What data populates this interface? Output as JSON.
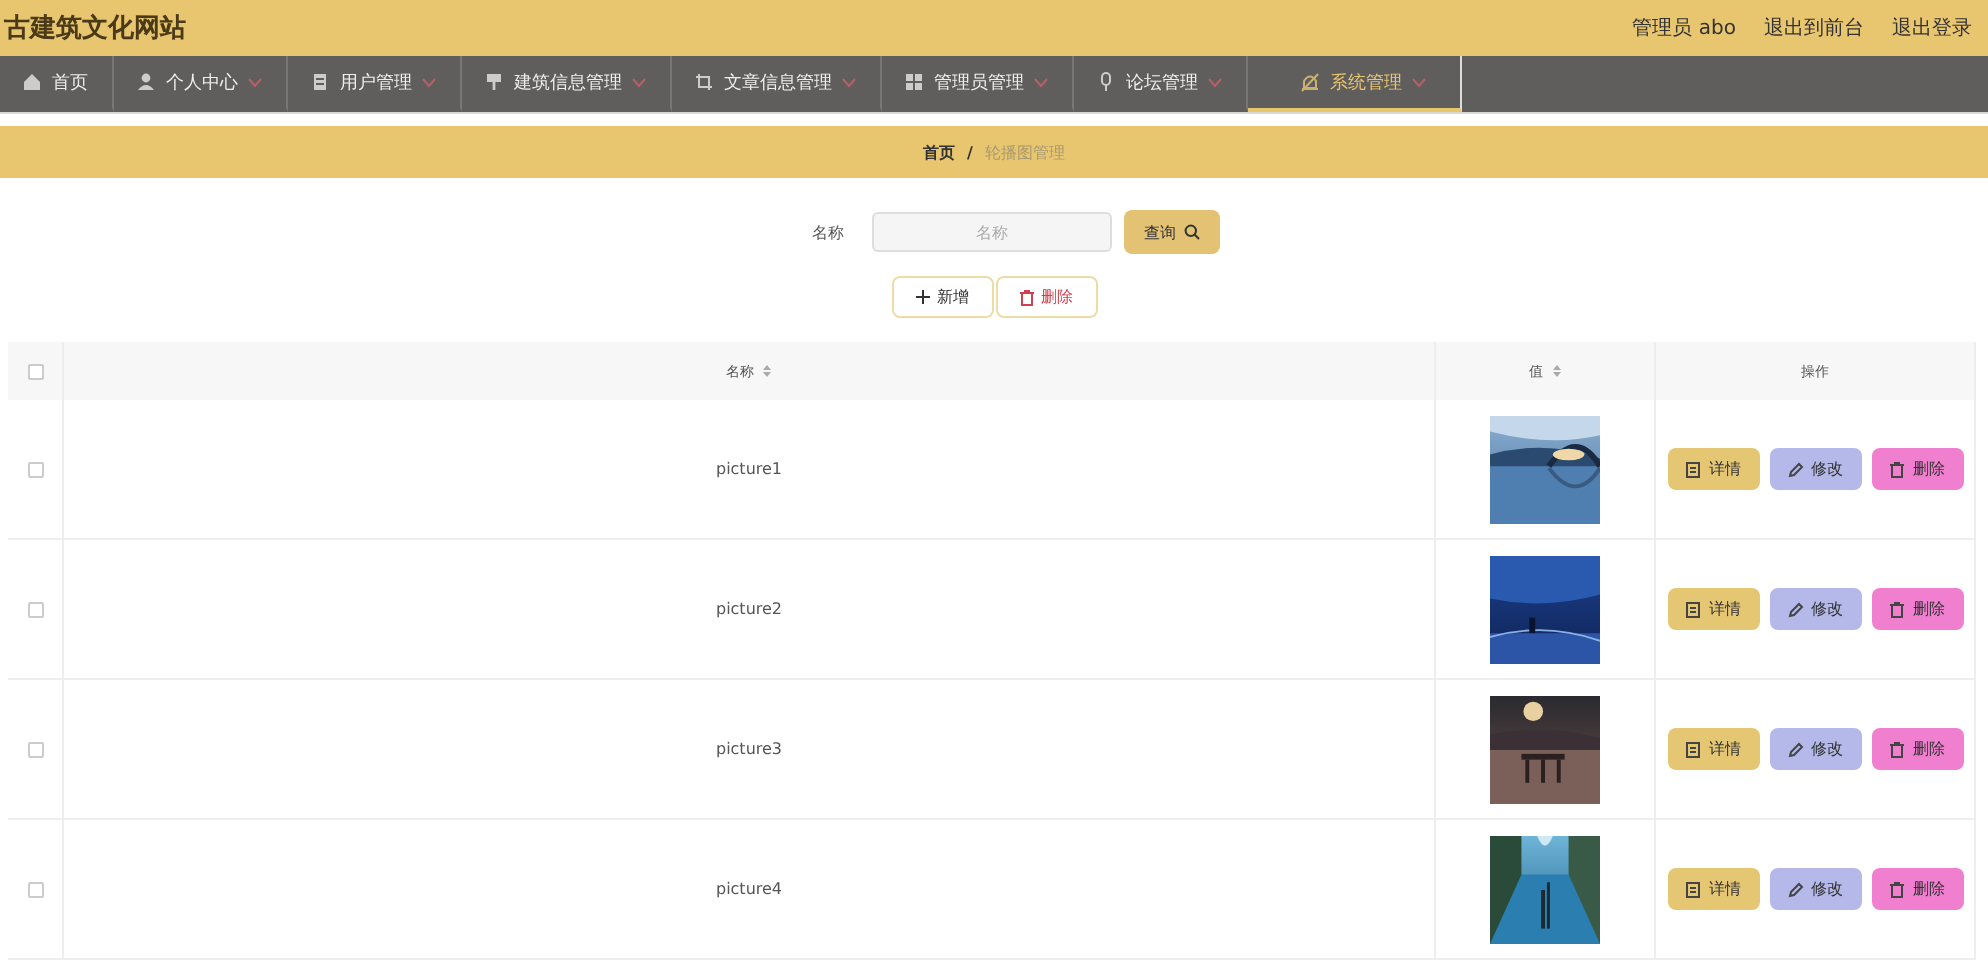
{
  "header": {
    "title": "古建筑文化网站",
    "links": [
      {
        "label": "管理员 abo"
      },
      {
        "label": "退出到前台"
      },
      {
        "label": "退出登录"
      }
    ]
  },
  "nav": [
    {
      "label": "首页",
      "has_menu": false,
      "selected": false
    },
    {
      "label": "个人中心",
      "has_menu": true,
      "selected": false
    },
    {
      "label": "用户管理",
      "has_menu": true,
      "selected": false
    },
    {
      "label": "建筑信息管理",
      "has_menu": true,
      "selected": false
    },
    {
      "label": "文章信息管理",
      "has_menu": true,
      "selected": false
    },
    {
      "label": "管理员管理",
      "has_menu": true,
      "selected": false
    },
    {
      "label": "论坛管理",
      "has_menu": true,
      "selected": false
    },
    {
      "label": "系统管理",
      "has_menu": true,
      "selected": true
    }
  ],
  "breadcrumb": {
    "separator": "/",
    "items": [
      {
        "label": "首页"
      },
      {
        "label": "轮播图管理"
      }
    ]
  },
  "search": {
    "label": "名称",
    "placeholder": "名称",
    "button": "查询"
  },
  "actions": [
    {
      "kind": "add",
      "label": "新增"
    },
    {
      "kind": "delete",
      "label": "删除"
    }
  ],
  "table": {
    "columns": [
      {
        "label": "名称",
        "sortable": true
      },
      {
        "label": "值",
        "sortable": true
      },
      {
        "label": "操作",
        "sortable": false
      }
    ],
    "all_checked": false,
    "rows": [
      {
        "checked": false,
        "name": "picture1",
        "buttons": [
          {
            "kind": "detail",
            "label": "详情"
          },
          {
            "kind": "edit",
            "label": "修改"
          },
          {
            "kind": "delete",
            "label": "删除"
          }
        ]
      },
      {
        "checked": false,
        "name": "picture2",
        "buttons": [
          {
            "kind": "detail",
            "label": "详情"
          },
          {
            "kind": "edit",
            "label": "修改"
          },
          {
            "kind": "delete",
            "label": "删除"
          }
        ]
      },
      {
        "checked": false,
        "name": "picture3",
        "buttons": [
          {
            "kind": "detail",
            "label": "详情"
          },
          {
            "kind": "edit",
            "label": "修改"
          },
          {
            "kind": "delete",
            "label": "删除"
          }
        ]
      },
      {
        "checked": false,
        "name": "picture4",
        "buttons": [
          {
            "kind": "detail",
            "label": "详情"
          },
          {
            "kind": "edit",
            "label": "修改"
          },
          {
            "kind": "delete",
            "label": "删除"
          }
        ]
      }
    ]
  }
}
